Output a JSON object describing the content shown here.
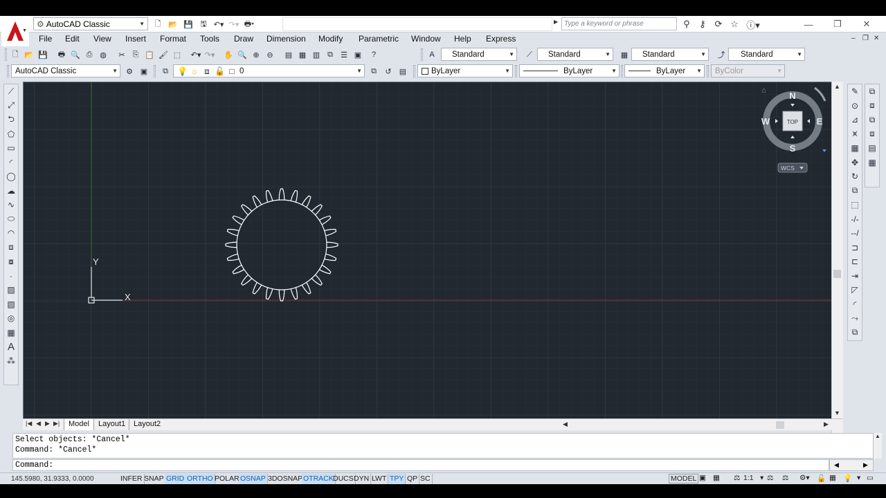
{
  "title_bar": {
    "workspace": "AutoCAD Classic",
    "search_placeholder": "Type a keyword or phrase"
  },
  "menu": [
    "File",
    "Edit",
    "View",
    "Insert",
    "Format",
    "Tools",
    "Draw",
    "Dimension",
    "Modify",
    "Parametric",
    "Window",
    "Help",
    "Express"
  ],
  "styles_toolbar": {
    "text_style": "Standard",
    "dim_style": "Standard",
    "table_style": "Standard",
    "mleader_style": "Standard"
  },
  "layers_toolbar": {
    "workspace": "AutoCAD Classic",
    "current_layer": "0",
    "color": "ByLayer",
    "linetype": "ByLayer",
    "lineweight": "ByLayer",
    "plotstyle": "ByColor"
  },
  "viewcube": {
    "north": "N",
    "south": "S",
    "east": "E",
    "west": "W",
    "face": "TOP",
    "ucs": "WCS"
  },
  "ucs_icon": {
    "x_label": "X",
    "y_label": "Y"
  },
  "drawing": {
    "gear_teeth": 24,
    "colors": {
      "background": "#212830",
      "entity": "#ffffff",
      "x_axis": "#7a3a2e",
      "y_axis": "#3a6b3a"
    }
  },
  "tabs": [
    "Model",
    "Layout1",
    "Layout2"
  ],
  "command": {
    "history": [
      "Select objects: *Cancel*",
      "Command: *Cancel*"
    ],
    "prompt": "Command:"
  },
  "status": {
    "coords": "145.5980, 31.9333, 0.0000",
    "toggles": [
      {
        "label": "INFER",
        "on": false
      },
      {
        "label": "SNAP",
        "on": false
      },
      {
        "label": "GRID",
        "on": true
      },
      {
        "label": "ORTHO",
        "on": true
      },
      {
        "label": "POLAR",
        "on": false
      },
      {
        "label": "OSNAP",
        "on": true
      },
      {
        "label": "3DOSNAP",
        "on": false
      },
      {
        "label": "OTRACK",
        "on": true
      },
      {
        "label": "DUCS",
        "on": false
      },
      {
        "label": "DYN",
        "on": false
      },
      {
        "label": "LWT",
        "on": false
      },
      {
        "label": "TPY",
        "on": true
      },
      {
        "label": "QP",
        "on": false
      },
      {
        "label": "SC",
        "on": false
      }
    ],
    "model": "MODEL",
    "scale": "1:1"
  }
}
